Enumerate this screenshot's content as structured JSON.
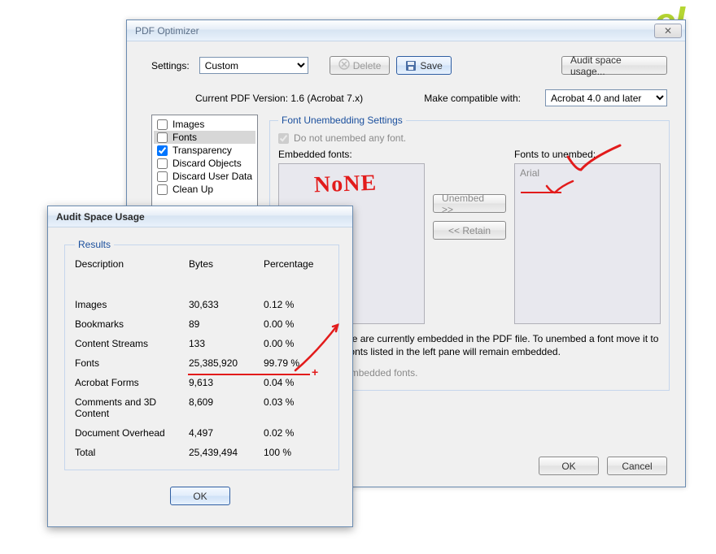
{
  "bg_logo_fragment": "el",
  "optimizer": {
    "title": "PDF Optimizer",
    "settings_label": "Settings:",
    "settings_value": "Custom",
    "delete_label": "Delete",
    "save_label": "Save",
    "audit_btn": "Audit space usage...",
    "version_label": "Current PDF Version: 1.6 (Acrobat 7.x)",
    "compat_label": "Make compatible with:",
    "compat_value": "Acrobat 4.0 and later",
    "categories": [
      {
        "label": "Images",
        "checked": false,
        "selected": false
      },
      {
        "label": "Fonts",
        "checked": false,
        "selected": true
      },
      {
        "label": "Transparency",
        "checked": true,
        "selected": false
      },
      {
        "label": "Discard Objects",
        "checked": false,
        "selected": false
      },
      {
        "label": "Discard User Data",
        "checked": false,
        "selected": false
      },
      {
        "label": "Clean Up",
        "checked": false,
        "selected": false
      }
    ],
    "fonts_panel": {
      "legend": "Font Unembedding Settings",
      "do_not_unembed_label": "Do not unembed any font.",
      "embedded_label": "Embedded fonts:",
      "unembed_label": "Fonts to unembed:",
      "unembed_btn": "Unembed >>",
      "retain_btn": "<< Retain",
      "unembed_list": [
        "Arial"
      ],
      "desc": "Fonts listed above are currently embedded in the PDF file. To unembed a font move it to the right pane. Fonts listed in the left pane will remain embedded.",
      "subset_label": "Subset all embedded fonts."
    },
    "ok_label": "OK",
    "cancel_label": "Cancel",
    "annotation_none": "NoNE"
  },
  "audit": {
    "title": "Audit Space Usage",
    "legend": "Results",
    "headers": {
      "desc": "Description",
      "bytes": "Bytes",
      "pct": "Percentage"
    },
    "rows": [
      {
        "desc": "Images",
        "bytes": "30,633",
        "pct": "0.12 %"
      },
      {
        "desc": "Bookmarks",
        "bytes": "89",
        "pct": "0.00 %"
      },
      {
        "desc": "Content Streams",
        "bytes": "133",
        "pct": "0.00 %"
      },
      {
        "desc": "Fonts",
        "bytes": "25,385,920",
        "pct": "99.79 %"
      },
      {
        "desc": "Acrobat Forms",
        "bytes": "9,613",
        "pct": "0.04 %"
      },
      {
        "desc": "Comments and 3D Content",
        "bytes": "8,609",
        "pct": "0.03 %"
      },
      {
        "desc": "Document Overhead",
        "bytes": "4,497",
        "pct": "0.02 %"
      },
      {
        "desc": "Total",
        "bytes": "25,439,494",
        "pct": "100 %"
      }
    ],
    "ok_label": "OK"
  }
}
